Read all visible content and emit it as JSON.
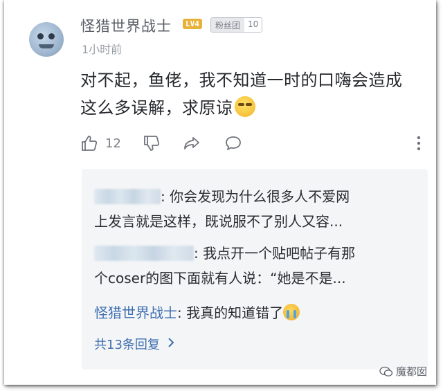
{
  "comment": {
    "username": "怪猎世界战士",
    "level": "LV4",
    "fan_label": "粉丝团",
    "fan_level": "10",
    "timestamp": "1小时前",
    "text_line1": "对不起，鱼佬，我不知道一时的口嗨会造成",
    "text_line2": "这么多误解，求原谅",
    "like_count": "12"
  },
  "icons": {
    "like": "thumbs-up-icon",
    "dislike": "thumbs-down-icon",
    "share": "share-icon",
    "reply": "comment-bubble-icon",
    "more": "more-vertical-icon"
  },
  "replies": [
    {
      "author": "",
      "text_line1": ": 你会发现为什么很多人不爱网",
      "text_line2": "上发言就是这样，既说服不了别人又容..."
    },
    {
      "author": "",
      "text_line1": ": 我点开一个贴吧帖子有那",
      "text_line2": "个coser的图下面就有人说：“她是不是..."
    },
    {
      "author": "怪猎世界战士",
      "text_line1": ": 我真的知道错了"
    }
  ],
  "more_replies": "共13条回复",
  "watermark": "魔都囡",
  "colors": {
    "link_blue": "#3e6fb0",
    "text_dark": "#26282d",
    "text_gray": "#9a9ea6",
    "reply_bg": "#f4f5f7",
    "level_badge": "#e8b23a"
  }
}
